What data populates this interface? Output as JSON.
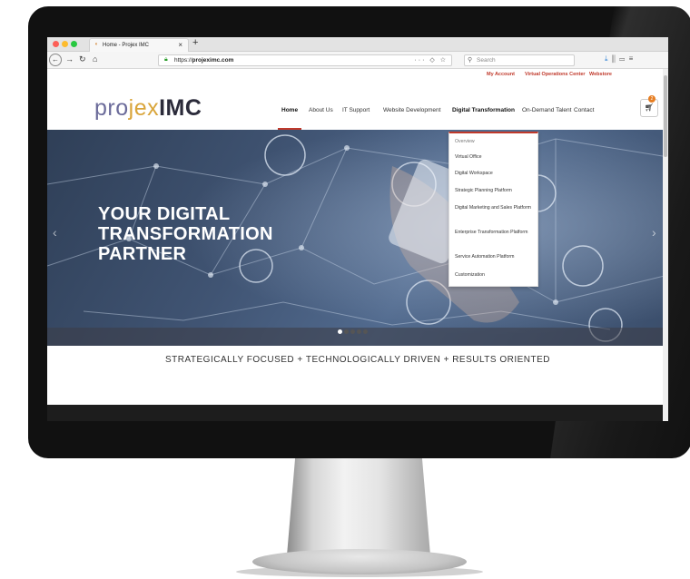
{
  "browser": {
    "tab_title": "Home - Projex IMC",
    "url_prefix": "https://",
    "url_domain": "projeximc.com",
    "search_placeholder": "Search"
  },
  "topbar": {
    "links": [
      "My Account",
      "Virtual Operations Center",
      "Webstore"
    ]
  },
  "header": {
    "logo_part1": "pro",
    "logo_part2": "jex",
    "logo_part3": "IMC",
    "menu": [
      "Home",
      "About Us",
      "IT Support",
      "Website Development",
      "Digital Transformation",
      "On-Demand Talent",
      "Contact"
    ],
    "cart_count": "2"
  },
  "dropdown": {
    "items": [
      "Overview",
      "Virtual Office",
      "Digital Workspace",
      "Strategic Planning Platform",
      "Digital Marketing and Sales Platform",
      "Enterprise Transformation Platform",
      "Service Automation Platform",
      "Customization"
    ]
  },
  "hero": {
    "line1": "YOUR DIGITAL",
    "line2": "TRANSFORMATION",
    "line3": "PARTNER",
    "slide_count": 5,
    "active_slide": 1
  },
  "tagline": "STRATEGICALLY FOCUSED + TECHNOLOGICALLY DRIVEN + RESULTS ORIENTED",
  "colors": {
    "accent": "#c0392b",
    "hero_base": "#405473",
    "logo_gold": "#d9a53a",
    "logo_purple": "#6b6b9a"
  }
}
